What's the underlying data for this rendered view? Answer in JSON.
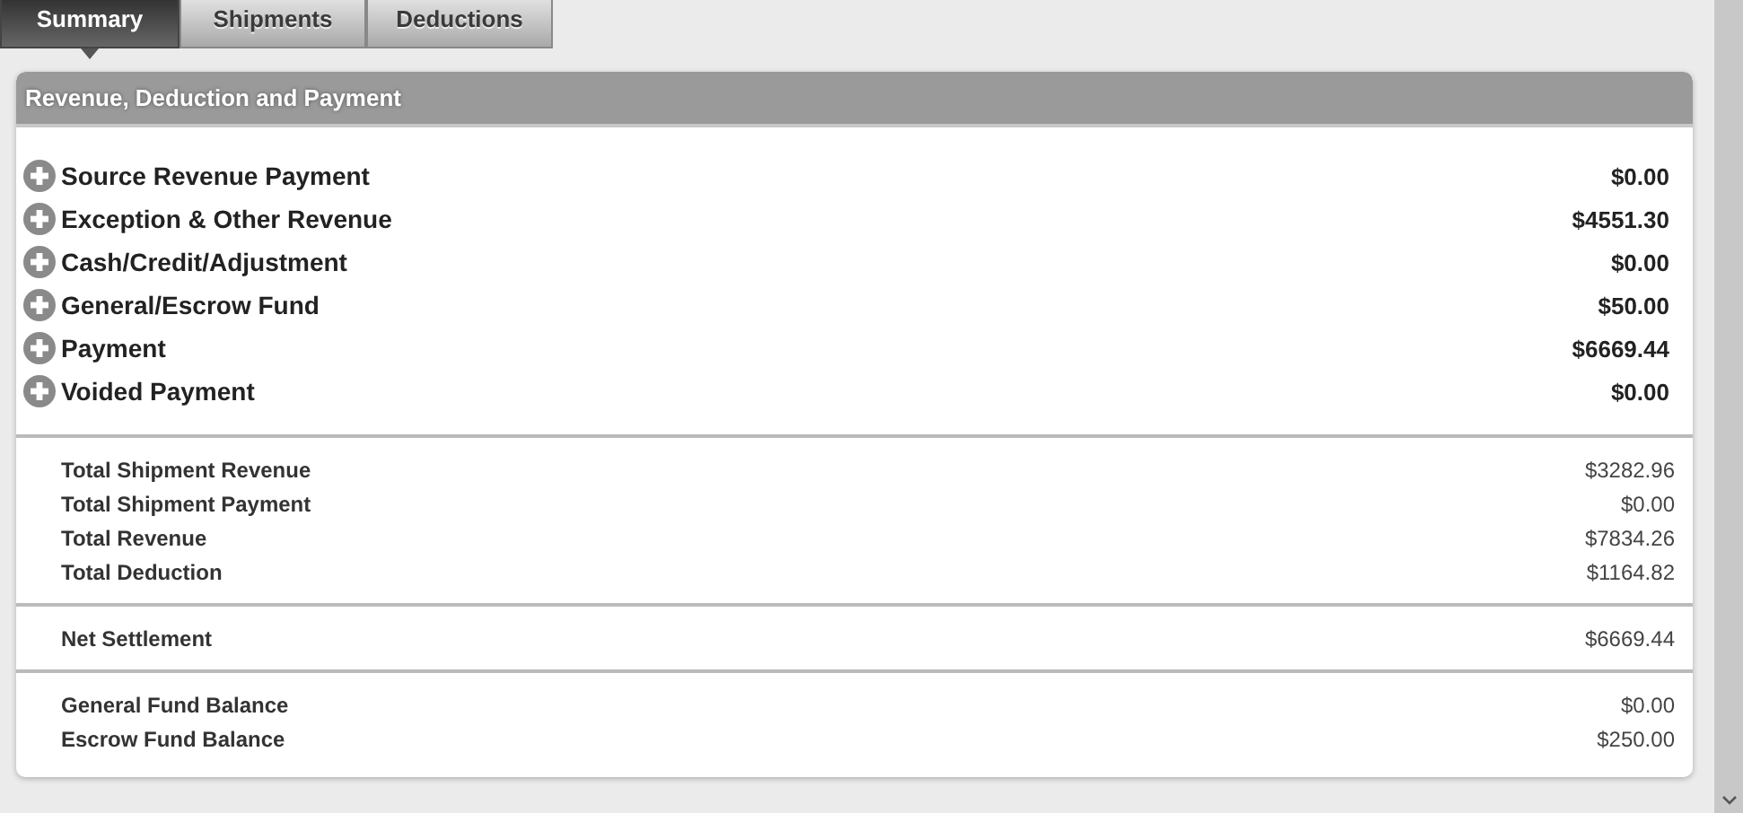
{
  "tabs": [
    {
      "label": "Summary",
      "selected": true
    },
    {
      "label": "Shipments",
      "selected": false
    },
    {
      "label": "Deductions",
      "selected": false
    }
  ],
  "panel": {
    "title": "Revenue, Deduction and Payment",
    "categories": [
      {
        "label": "Source Revenue Payment",
        "amount": "$0.00",
        "expanded": false
      },
      {
        "label": "Exception & Other Revenue",
        "amount": "$4551.30",
        "expanded": false
      },
      {
        "label": "Cash/Credit/Adjustment",
        "amount": "$0.00",
        "expanded": false
      },
      {
        "label": "General/Escrow Fund",
        "amount": "$50.00",
        "expanded": false
      },
      {
        "label": "Payment",
        "amount": "$6669.44",
        "expanded": false
      },
      {
        "label": "Voided Payment",
        "amount": "$0.00",
        "expanded": false
      }
    ],
    "summary_groups": [
      [
        {
          "label": "Total Shipment Revenue",
          "amount": "$3282.96"
        },
        {
          "label": "Total Shipment Payment",
          "amount": "$0.00"
        },
        {
          "label": "Total Revenue",
          "amount": "$7834.26"
        },
        {
          "label": "Total Deduction",
          "amount": "$1164.82"
        }
      ],
      [
        {
          "label": "Net Settlement",
          "amount": "$6669.44"
        }
      ],
      [
        {
          "label": "General Fund Balance",
          "amount": "$0.00"
        },
        {
          "label": "Escrow Fund Balance",
          "amount": "$250.00"
        }
      ]
    ]
  }
}
